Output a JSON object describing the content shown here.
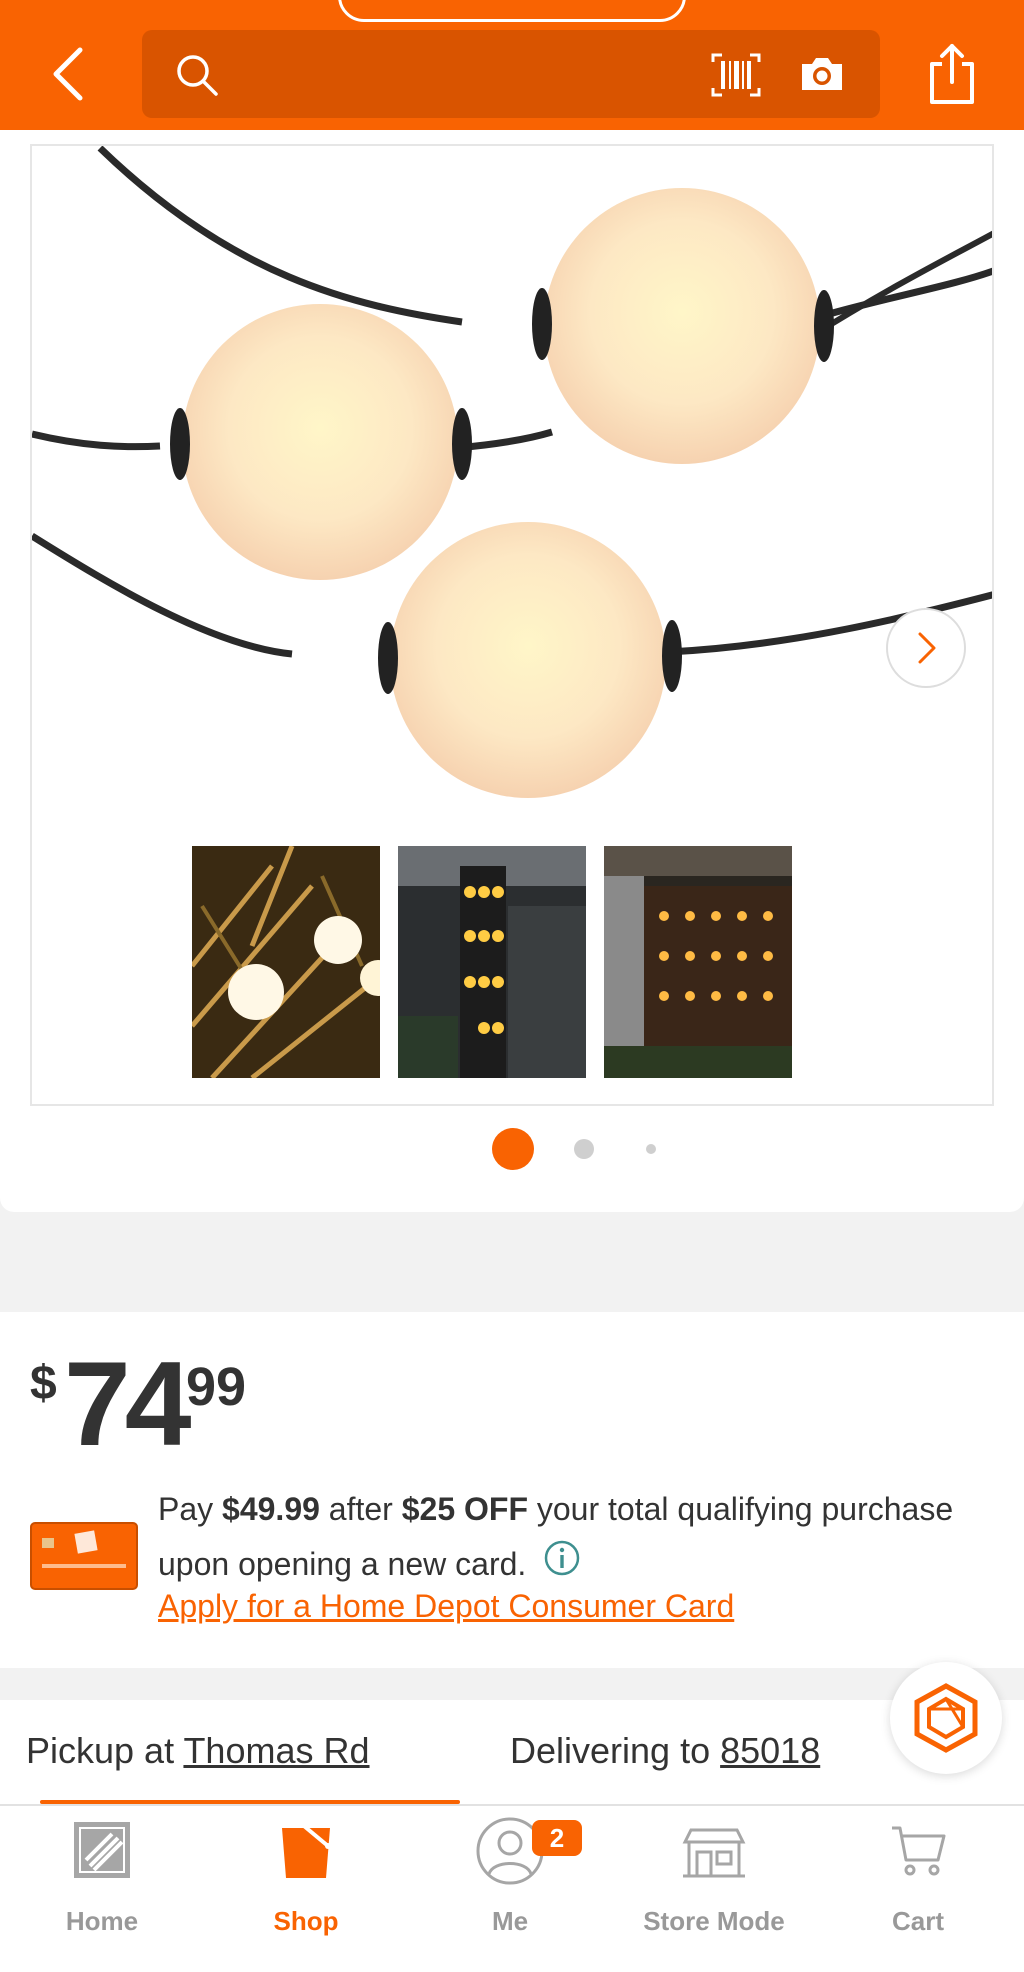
{
  "header": {
    "search_placeholder": "",
    "icons": [
      "back-arrow-icon",
      "search-icon",
      "barcode-icon",
      "camera-icon",
      "share-icon"
    ]
  },
  "gallery": {
    "thumbnail_count": 3,
    "active_dot": 0,
    "dot_count": 3
  },
  "price": {
    "dollar_sign": "$",
    "whole": "74",
    "cents": "99"
  },
  "promo": {
    "pay_prefix": "Pay",
    "pay_amount": "$49.99",
    "after": "after",
    "discount": "$25 OFF",
    "rest_line1": "your total qualifying purchase upon opening a new card.",
    "apply_link": "Apply for a Home Depot Consumer Card"
  },
  "fulfillment": {
    "pickup_label": "Pickup at",
    "pickup_store": "Thomas Rd",
    "delivery_label": "Delivering to",
    "delivery_zip": "85018"
  },
  "nav": {
    "items": [
      {
        "label": "Home",
        "icon": "home-depot-logo-icon"
      },
      {
        "label": "Shop",
        "icon": "shop-bucket-icon"
      },
      {
        "label": "Me",
        "icon": "profile-icon",
        "badge": "2"
      },
      {
        "label": "Store Mode",
        "icon": "store-icon"
      },
      {
        "label": "Cart",
        "icon": "cart-icon"
      }
    ],
    "active": "Shop"
  },
  "colors": {
    "brand_orange": "#f96302",
    "search_bg": "#d95400",
    "info_teal": "#3e8f8f"
  }
}
